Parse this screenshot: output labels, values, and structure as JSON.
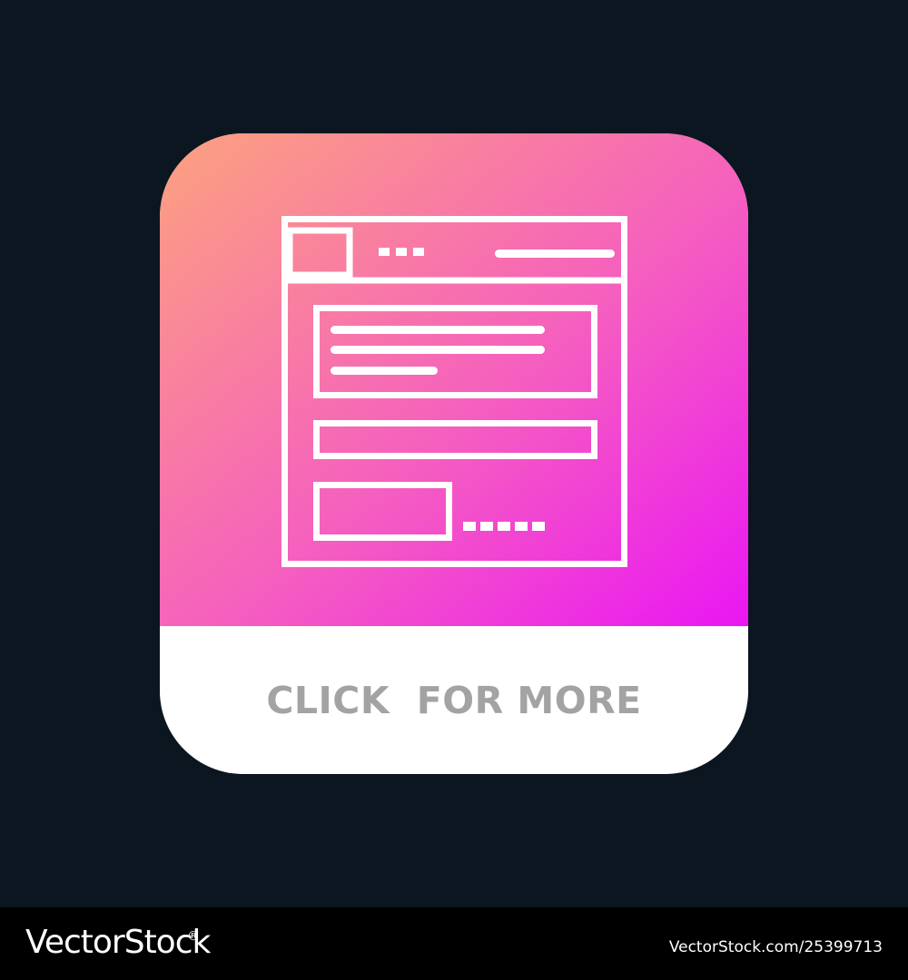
{
  "button": {
    "cta_label": "CLICK  FOR MORE",
    "gradient_start": "#fca27e",
    "gradient_end": "#ea16f3",
    "bottom_color": "#ffffff",
    "label_color": "#a3a3a3"
  },
  "icon": {
    "name": "browser-window-layout-icon",
    "stroke_color": "#ffffff"
  },
  "background_color": "#0c1620",
  "footer": {
    "brand_text": "VectorStock",
    "registered_mark": "®",
    "stock_id": "VectorStock.com/25399713"
  }
}
